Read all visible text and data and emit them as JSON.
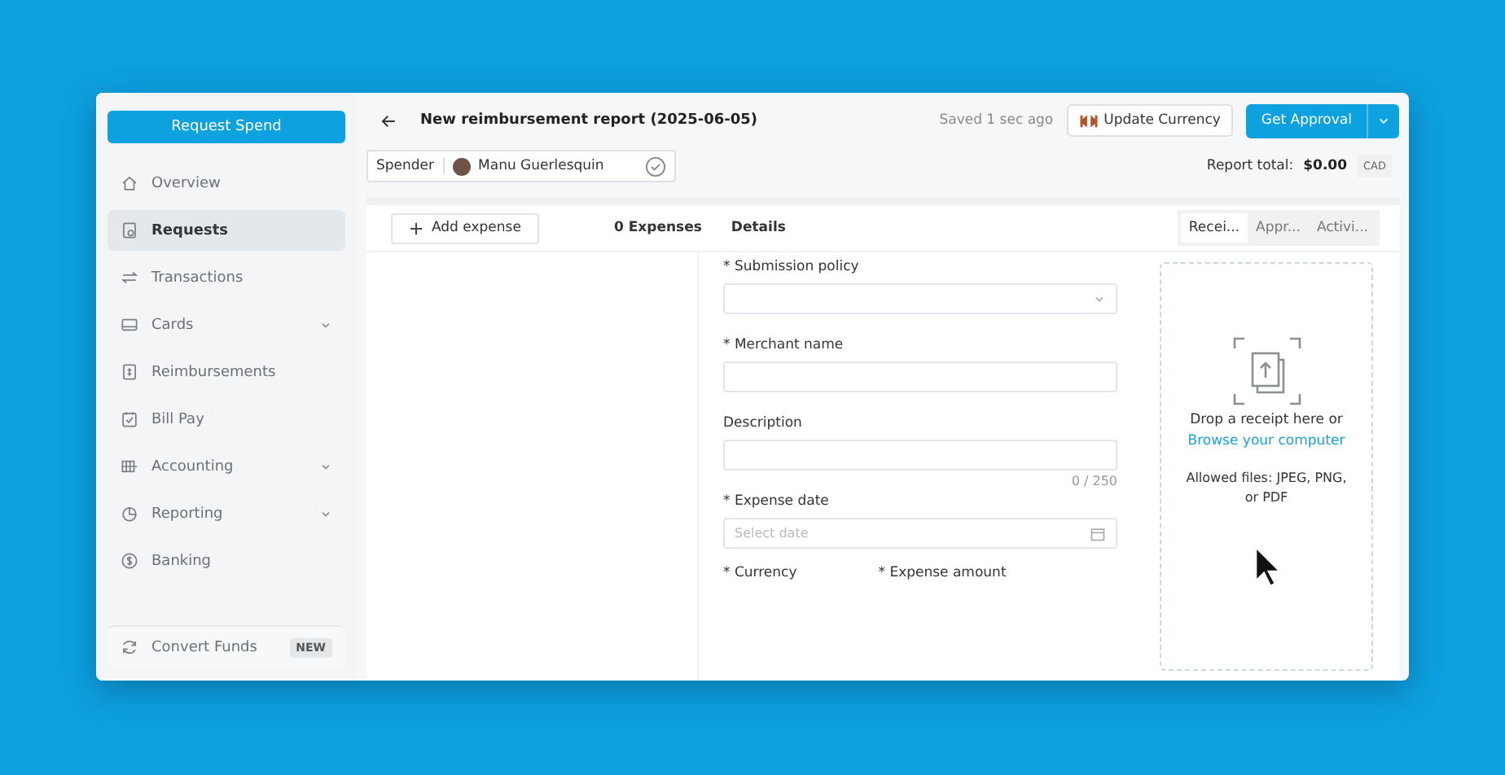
{
  "sidebar": {
    "primary_button": "Request Spend",
    "items": [
      {
        "label": "Overview",
        "selected": false,
        "expandable": false
      },
      {
        "label": "Requests",
        "selected": true,
        "expandable": false
      },
      {
        "label": "Transactions",
        "selected": false,
        "expandable": false
      },
      {
        "label": "Cards",
        "selected": false,
        "expandable": true
      },
      {
        "label": "Reimbursements",
        "selected": false,
        "expandable": false
      },
      {
        "label": "Bill Pay",
        "selected": false,
        "expandable": false
      },
      {
        "label": "Accounting",
        "selected": false,
        "expandable": true
      },
      {
        "label": "Reporting",
        "selected": false,
        "expandable": true
      },
      {
        "label": "Banking",
        "selected": false,
        "expandable": false
      }
    ],
    "footer_item": {
      "label": "Convert Funds",
      "badge": "NEW"
    }
  },
  "header": {
    "title": "New reimbursement report (2025-06-05)",
    "saved": "Saved 1 sec ago",
    "update_button": "Update Currency",
    "approval_button": "Get Approval"
  },
  "spender": {
    "label": "Spender",
    "name": "Manu Guerlesquin",
    "total_label": "Report total:",
    "total": "$0.00",
    "currency": "CAD"
  },
  "expenses": {
    "add_button": "Add expense",
    "count": "0 Expenses"
  },
  "details": {
    "title": "Details",
    "fields": [
      {
        "label": "* Submission policy",
        "kind": "select"
      },
      {
        "label": "* Merchant name",
        "kind": "text"
      },
      {
        "label": "Description",
        "kind": "textarea",
        "counter": "0 / 250"
      },
      {
        "label": "* Expense date",
        "kind": "date",
        "placeholder": "Select date"
      }
    ],
    "bottom_fields": [
      {
        "label": "* Currency"
      },
      {
        "label": "* Expense amount"
      }
    ]
  },
  "side_tabs": [
    {
      "label": "Recei...",
      "selected": true
    },
    {
      "label": "Appr...",
      "selected": false
    },
    {
      "label": "Activi...",
      "selected": false
    }
  ],
  "dropzone": {
    "text": "Drop a receipt here or",
    "link": "Browse your computer",
    "allowed": "Allowed files: JPEG, PNG, or PDF"
  }
}
